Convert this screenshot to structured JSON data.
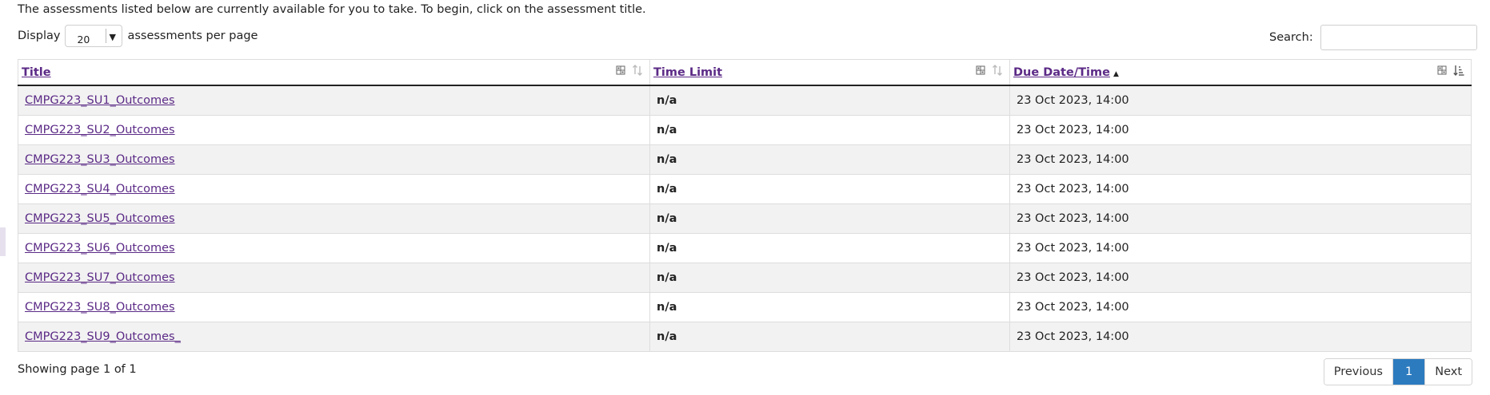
{
  "intro_text": "The assessments listed below are currently available for you to take. To begin, click on the assessment title.",
  "display": {
    "label_before": "Display",
    "value": "20",
    "label_after": "assessments per page"
  },
  "search": {
    "label": "Search:",
    "value": ""
  },
  "table": {
    "headers": {
      "title": "Title",
      "time_limit": "Time Limit",
      "due": "Due Date/Time"
    },
    "rows": [
      {
        "title": "CMPG223_SU1_Outcomes",
        "time_limit": "n/a",
        "due": "23 Oct 2023, 14:00"
      },
      {
        "title": "CMPG223_SU2_Outcomes",
        "time_limit": "n/a",
        "due": "23 Oct 2023, 14:00"
      },
      {
        "title": "CMPG223_SU3_Outcomes",
        "time_limit": "n/a",
        "due": "23 Oct 2023, 14:00"
      },
      {
        "title": "CMPG223_SU4_Outcomes",
        "time_limit": "n/a",
        "due": "23 Oct 2023, 14:00"
      },
      {
        "title": "CMPG223_SU5_Outcomes",
        "time_limit": "n/a",
        "due": "23 Oct 2023, 14:00"
      },
      {
        "title": "CMPG223_SU6_Outcomes",
        "time_limit": "n/a",
        "due": "23 Oct 2023, 14:00"
      },
      {
        "title": "CMPG223_SU7_Outcomes",
        "time_limit": "n/a",
        "due": "23 Oct 2023, 14:00"
      },
      {
        "title": "CMPG223_SU8_Outcomes",
        "time_limit": "n/a",
        "due": "23 Oct 2023, 14:00"
      },
      {
        "title": "CMPG223_SU9_Outcomes_",
        "time_limit": "n/a",
        "due": "23 Oct 2023, 14:00"
      }
    ]
  },
  "footer": {
    "showing": "Showing page 1 of 1",
    "pager": {
      "previous": "Previous",
      "current": "1",
      "next": "Next"
    }
  },
  "colors": {
    "link": "#5b2a86",
    "active_page": "#2c7bbf",
    "row_stripe": "#f2f2f2"
  },
  "icons": {
    "column_toggle": "column-toggle-icon",
    "sort_unsorted": "sort-updown-icon",
    "sort_ascending": "sort-ascending-icon"
  }
}
